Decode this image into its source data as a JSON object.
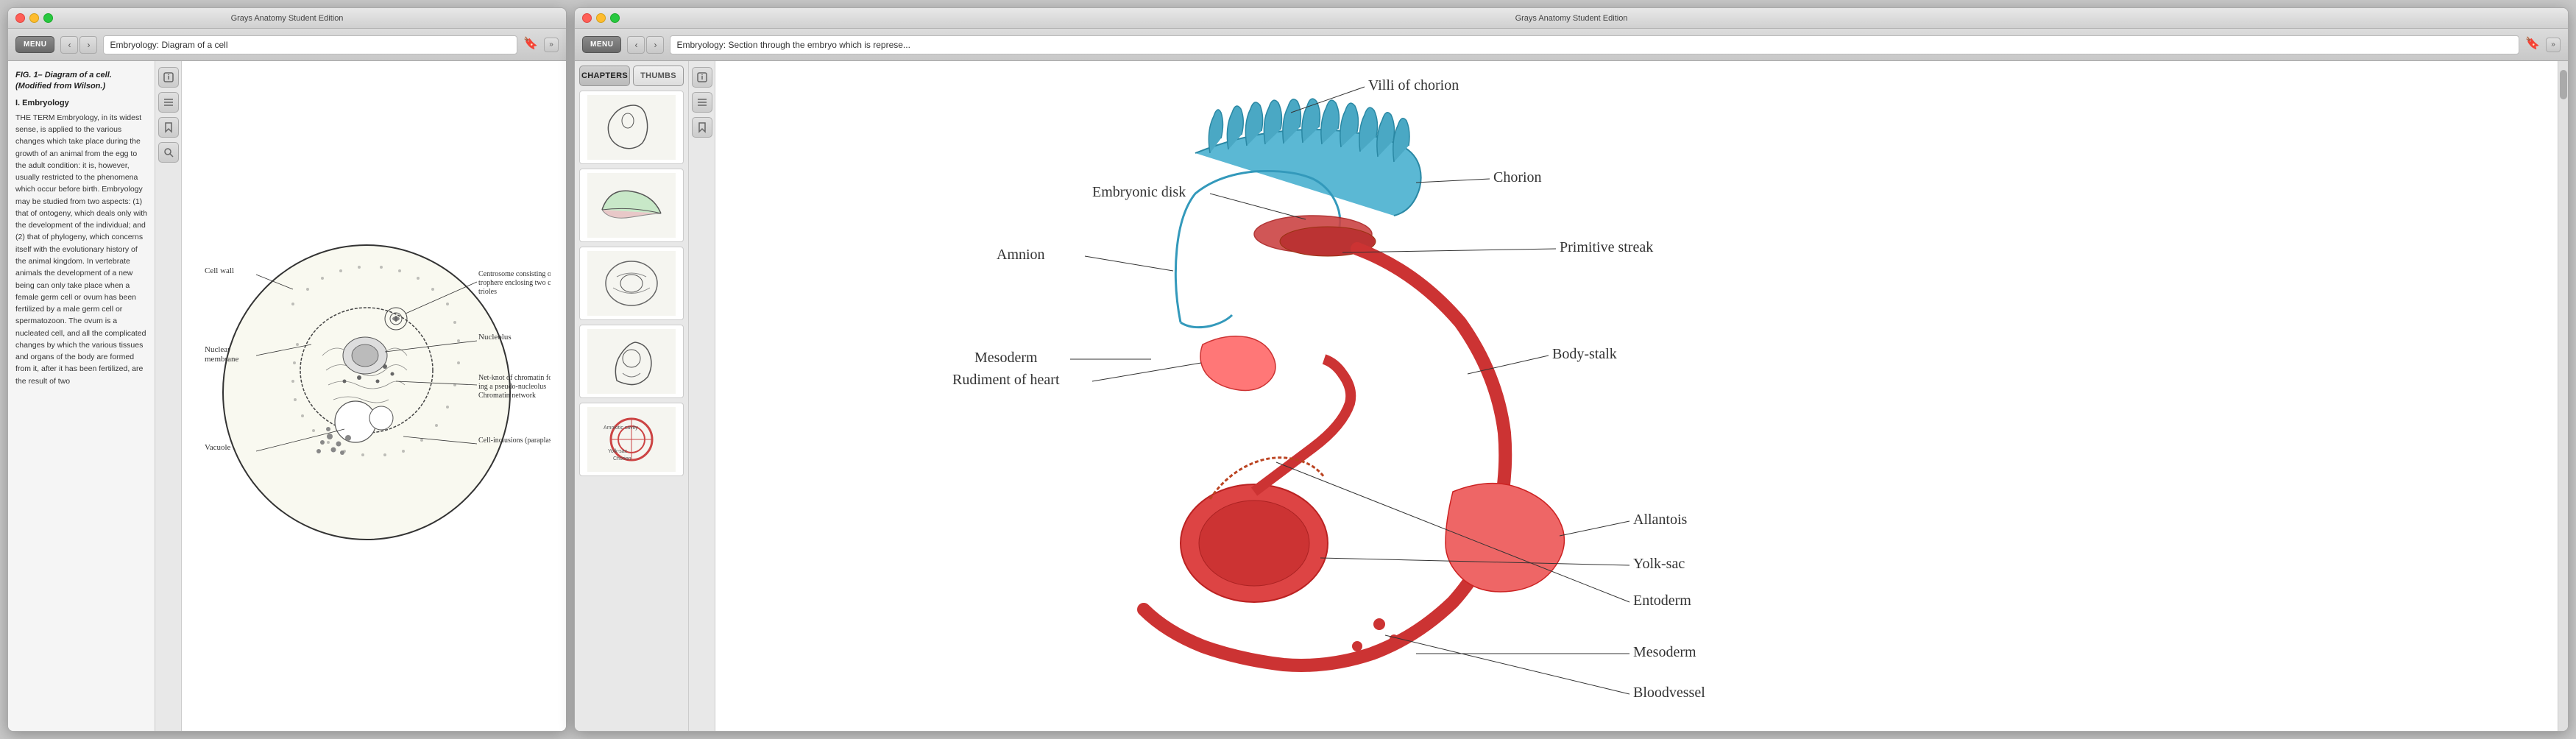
{
  "leftWindow": {
    "title": "Grays Anatomy Student Edition",
    "breadcrumb": "Embryology: Diagram of a cell",
    "menuLabel": "MENU",
    "infoLabel": "INFO",
    "figureCaption": "FIG. 1– Diagram of a cell. (Modified from Wilson.)",
    "sectionHeading": "I. Embryology",
    "bodyText": "THE TERM Embryology, in its widest sense, is applied to the various changes which take place during the growth of an animal from the egg to the adult condition: it is, however, usually restricted to the phenomena which occur before birth. Embryology may be studied from two aspects: (1) that of ontogeny, which deals only with the development of the individual; and (2) that of phylogeny, which concerns itself with the evolutionary history of the animal kingdom. In vertebrate animals the development of a new being can only take place when a female germ cell or ovum has been fertilized by a male germ cell or spermatozoon. The ovum is a nucleated cell, and all the complicated changes by which the various tissues and organs of the body are formed from it, after it has been fertilized, are the result of two",
    "diagramLabels": {
      "cellWall": "Cell wall",
      "nuclearMembrane": "Nuclear membrane",
      "vacuole": "Vacuole",
      "centrosome": "Centrosome consisting of cen-trophere enclosing two cen-trioles",
      "nucleolus": "Nucleolus",
      "netKnot": "Net-knot of chromatin form-ing a pseudo-nucleolus Chromatin network",
      "cellInclusions": "Cell-inclusions (paraplasm)"
    }
  },
  "rightWindow": {
    "title": "Grays Anatomy Student Edition",
    "breadcrumb": "Embryology: Section through the embryo which is represe...",
    "menuLabel": "MENU",
    "chaptersLabel": "CHAPTERS",
    "thumbsLabel": "THUMBS",
    "anatomyLabels": {
      "villiOfChorion": "Villi of chorion",
      "chorion": "Chorion",
      "amnion": "Amnion",
      "mesoderm": "Mesoderm",
      "embryonicDisk": "Embryonic disk",
      "bodyStalk": "Body-stalk",
      "primitiveStreak": "Primitive streak",
      "rudimentOfHeart": "Rudiment of heart",
      "allantois": "Allantois",
      "yolkSac": "Yolk-sac",
      "entoderm": "Entoderm",
      "mesoderm2": "Mesoderm",
      "bloodVessel": "Bloodvessel"
    }
  }
}
